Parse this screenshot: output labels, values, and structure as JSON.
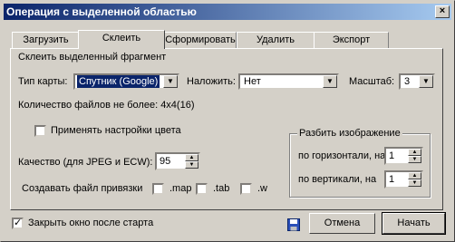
{
  "window": {
    "title": "Операция с выделенной областью",
    "close_glyph": "×"
  },
  "tabs": [
    {
      "label": "Загрузить"
    },
    {
      "label": "Склеить"
    },
    {
      "label": "Сформировать"
    },
    {
      "label": "Удалить"
    },
    {
      "label": "Экспорт"
    }
  ],
  "panel": {
    "heading": "Склеить выделенный фрагмент",
    "map_type": {
      "label": "Тип карты:",
      "value": "Спутник (Google)"
    },
    "overlay": {
      "label": "Наложить:",
      "value": "Нет"
    },
    "scale": {
      "label": "Масштаб:",
      "value": "3"
    },
    "file_count": "Количество файлов не более: 4х4(16)",
    "apply_color": {
      "label": "Применять настройки цвета",
      "checked": false
    },
    "quality": {
      "label": "Качество (для JPEG и ECW):",
      "value": "95"
    },
    "binding": {
      "label": "Создавать файл привязки",
      "options": [
        {
          "label": ".map",
          "checked": false
        },
        {
          "label": ".tab",
          "checked": false
        },
        {
          "label": ".w",
          "checked": false
        }
      ]
    },
    "split": {
      "title": "Разбить изображение",
      "horizontal": {
        "label": "по горизонтали, на",
        "value": "1"
      },
      "vertical": {
        "label": "по вертикали, на",
        "value": "1"
      }
    }
  },
  "footer": {
    "close_after_start": {
      "label": "Закрыть окно после старта",
      "checked": true
    },
    "cancel_label": "Отмена",
    "start_label": "Начать"
  },
  "colors": {
    "title_from": "#0a246a",
    "title_to": "#a6caf0",
    "face": "#d4d0c8",
    "selection": "#0a246a"
  }
}
